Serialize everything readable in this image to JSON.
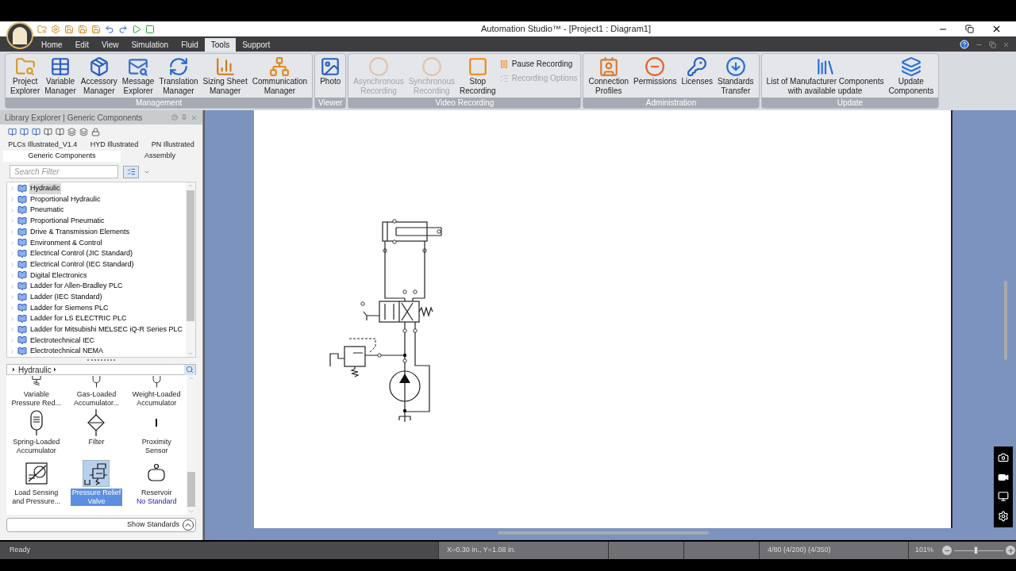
{
  "window": {
    "title": "Automation Studio™ - [Project1 : Diagram1]"
  },
  "menu": [
    {
      "label": "Home",
      "selected": false
    },
    {
      "label": "Edit",
      "selected": false
    },
    {
      "label": "View",
      "selected": false
    },
    {
      "label": "Simulation",
      "selected": false
    },
    {
      "label": "Fluid",
      "selected": false
    },
    {
      "label": "Tools",
      "selected": true
    },
    {
      "label": "Support",
      "selected": false
    }
  ],
  "ribbon": [
    {
      "label": "Management",
      "buttons": [
        {
          "kind": "large",
          "lines": [
            "Project",
            "Explorer"
          ],
          "disabled": false
        },
        {
          "kind": "large",
          "lines": [
            "Variable",
            "Manager"
          ],
          "disabled": false
        },
        {
          "kind": "large",
          "lines": [
            "Accessory",
            "Manager"
          ],
          "disabled": false
        },
        {
          "kind": "large",
          "lines": [
            "Message",
            "Explorer"
          ],
          "disabled": false
        },
        {
          "kind": "large",
          "lines": [
            "Translation",
            "Manager"
          ],
          "disabled": false
        },
        {
          "kind": "large",
          "lines": [
            "Sizing Sheet",
            "Manager"
          ],
          "disabled": false
        },
        {
          "kind": "large",
          "lines": [
            "Communication",
            "Manager"
          ],
          "disabled": false
        }
      ]
    },
    {
      "label": "Viewer",
      "buttons": [
        {
          "kind": "large",
          "lines": [
            "Photo"
          ],
          "disabled": false
        }
      ]
    },
    {
      "label": "Video Recording",
      "buttons": [
        {
          "kind": "large",
          "lines": [
            "Asynchronous",
            "Recording"
          ],
          "disabled": true
        },
        {
          "kind": "large",
          "lines": [
            "Synchronous",
            "Recording"
          ],
          "disabled": true
        },
        {
          "kind": "large",
          "lines": [
            "Stop",
            "Recording"
          ],
          "disabled": false
        },
        {
          "kind": "small",
          "lines": [
            "Pause Recording"
          ],
          "disabled": false
        },
        {
          "kind": "small",
          "lines": [
            "Recording Options"
          ],
          "disabled": true
        }
      ]
    },
    {
      "label": "Administration",
      "buttons": [
        {
          "kind": "large",
          "lines": [
            "Connection",
            "Profiles"
          ],
          "disabled": false
        },
        {
          "kind": "large",
          "lines": [
            "Permissions"
          ],
          "disabled": false
        },
        {
          "kind": "large",
          "lines": [
            "Licenses"
          ],
          "disabled": false
        },
        {
          "kind": "large",
          "lines": [
            "Standards",
            "Transfer"
          ],
          "disabled": false
        }
      ]
    },
    {
      "label": "Update",
      "buttons": [
        {
          "kind": "large",
          "lines": [
            "List of Manufacturer Components",
            "with available update"
          ],
          "disabled": false
        },
        {
          "kind": "large",
          "lines": [
            "Update",
            "Components"
          ],
          "disabled": false
        }
      ]
    }
  ],
  "library": {
    "title": "Library Explorer | Generic Components",
    "tabs": [
      {
        "label": "PLCs Illustrated_V1.4",
        "selected": false
      },
      {
        "label": "HYD Illustrated",
        "selected": false
      },
      {
        "label": "PN Illustrated",
        "selected": false
      },
      {
        "label": "Generic Components",
        "selected": true
      },
      {
        "label": "Assembly",
        "selected": false
      }
    ],
    "search": {
      "placeholder": "Search Filter"
    },
    "tree": [
      {
        "label": "Hydraulic",
        "selected": true
      },
      {
        "label": "Proportional Hydraulic",
        "selected": false
      },
      {
        "label": "Pneumatic",
        "selected": false
      },
      {
        "label": "Proportional Pneumatic",
        "selected": false
      },
      {
        "label": "Drive & Transmission Elements",
        "selected": false
      },
      {
        "label": "Environment & Control",
        "selected": false
      },
      {
        "label": "Electrical Control (JIC Standard)",
        "selected": false
      },
      {
        "label": "Electrical Control (IEC Standard)",
        "selected": false
      },
      {
        "label": "Digital Electronics",
        "selected": false
      },
      {
        "label": "Ladder for Allen-Bradley PLC",
        "selected": false
      },
      {
        "label": "Ladder (IEC Standard)",
        "selected": false
      },
      {
        "label": "Ladder for Siemens PLC",
        "selected": false
      },
      {
        "label": "Ladder for LS ELECTRIC PLC",
        "selected": false
      },
      {
        "label": "Ladder for Mitsubishi MELSEC iQ-R Series PLC",
        "selected": false
      },
      {
        "label": "Electrotechnical IEC",
        "selected": false
      },
      {
        "label": "Electrotechnical NEMA",
        "selected": false
      }
    ],
    "breadcrumb": "Hydraulic",
    "components": [
      {
        "kind": "reducer",
        "lines": [
          "Variable",
          "Pressure Red..."
        ],
        "selected": false
      },
      {
        "kind": "gas",
        "lines": [
          "Gas-Loaded",
          "Accumulator..."
        ],
        "selected": false
      },
      {
        "kind": "weight",
        "lines": [
          "Weight-Loaded",
          "Accumulator"
        ],
        "selected": false
      },
      {
        "kind": "spring",
        "lines": [
          "Spring-Loaded",
          "Accumulator"
        ],
        "selected": false
      },
      {
        "kind": "filter",
        "lines": [
          "Filter"
        ],
        "selected": false
      },
      {
        "kind": "sensor",
        "lines": [
          "Proximity",
          "Sensor"
        ],
        "selected": false
      },
      {
        "kind": "loadsensing",
        "lines": [
          "Load Sensing",
          "and Pressure..."
        ],
        "selected": false
      },
      {
        "kind": "relief",
        "lines": [
          "Pressure Relief",
          "Valve"
        ],
        "selected": true
      },
      {
        "kind": "reservoir",
        "lines": [
          "Reservoir"
        ],
        "note": "No Standard",
        "selected": false
      }
    ],
    "show_standards": "Show Standards"
  },
  "status_bar": {
    "state": "Ready",
    "coordinates": "X=0.30 in., Y=1.08 in.",
    "counts": "4/80 (4/200) (4/350)",
    "zoom": "101%",
    "zoom_slider": {
      "level": 0.45
    }
  }
}
